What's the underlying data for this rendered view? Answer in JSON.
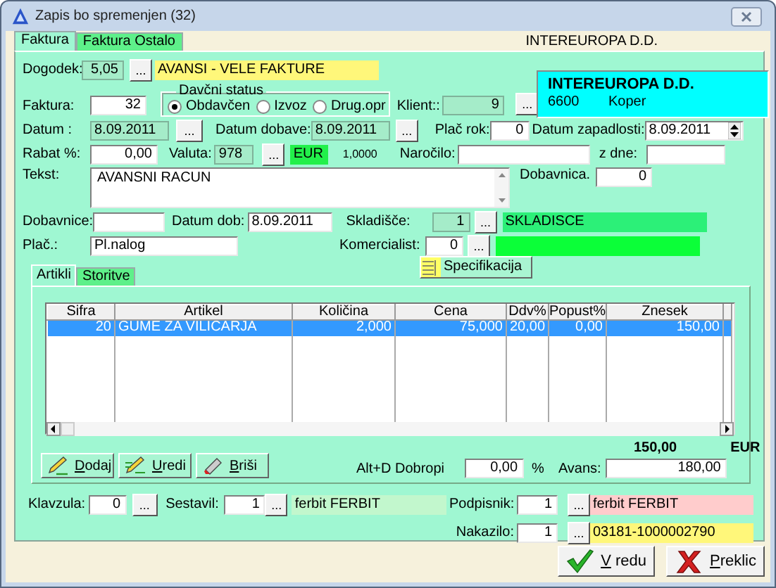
{
  "window": {
    "title": "Zapis bo spremenjen (32)"
  },
  "tabs": [
    {
      "label": "Faktura",
      "selected": true
    },
    {
      "label": "Faktura Ostalo",
      "selected": false
    }
  ],
  "company_header": "INTEREUROPA D.D.",
  "client_card": {
    "name": "INTEREUROPA D.D.",
    "postcode": "6600",
    "city": "Koper"
  },
  "dogodek": {
    "label": "Dogodek:",
    "code": "5,05",
    "readonly": true,
    "button": "...",
    "name": "AVANSI - VELE FAKTURE"
  },
  "tax_status": {
    "title": "Davčni status",
    "options": [
      {
        "label": "Obdavčen",
        "selected": true
      },
      {
        "label": "Izvoz",
        "selected": false
      },
      {
        "label": "Drug.opr",
        "selected": false
      }
    ]
  },
  "faktura": {
    "label": "Faktura:",
    "value": "32",
    "readonly": false
  },
  "klient": {
    "label": "Klient::",
    "value": "9",
    "readonly": true,
    "button": "..."
  },
  "datum": {
    "label": "Datum :",
    "value": "8.09.2011",
    "readonly": true,
    "button": "..."
  },
  "datum_dobave": {
    "label": "Datum dobave:",
    "value": "8.09.2011",
    "readonly": true,
    "button": "..."
  },
  "placilni_rok": {
    "label": "Plač rok:",
    "value": "0",
    "readonly": false
  },
  "datum_zapadlosti": {
    "label": "Datum zapadlosti:",
    "value": "8.09.2011",
    "readonly": false
  },
  "rabat": {
    "label": "Rabat %:",
    "value": "0,00",
    "readonly": false
  },
  "valuta": {
    "label": "Valuta:",
    "code": "978",
    "readonly": true,
    "button": "...",
    "name": "EUR",
    "rate": "1,0000"
  },
  "narocilo": {
    "label": "Naročilo:",
    "readonly": false
  },
  "z_dne": {
    "label": "z dne:",
    "readonly": false
  },
  "tekst": {
    "label": "Tekst:",
    "value": "AVANSNI RACUN",
    "readonly": false
  },
  "dobavnica": {
    "label": "Dobavnica.",
    "value": "0",
    "readonly": false
  },
  "dobavnice": {
    "label": "Dobavnice:",
    "readonly": false
  },
  "datum_dob": {
    "label": "Datum dob:",
    "value": "8.09.2011",
    "readonly": false
  },
  "skladisce": {
    "label": "Skladišče:",
    "code": "1",
    "readonly": true,
    "button": "...",
    "name": "SKLADISCE"
  },
  "placilo": {
    "label": "Plač.:",
    "value": "Pl.nalog",
    "readonly": false
  },
  "komercialist": {
    "label": "Komercialist:",
    "code": "0",
    "readonly": false,
    "button": "..."
  },
  "specifikacija_button": "Specifikacija",
  "item_tabs": [
    {
      "label": "Artikli",
      "selected": true
    },
    {
      "label": "Storitve",
      "selected": false
    }
  ],
  "table": {
    "columns": [
      "Sifra",
      "Artikel",
      "Količina",
      "Cena",
      "Ddv%",
      "Popust%",
      "Znesek"
    ],
    "rows": [
      {
        "selected": true,
        "cells": [
          "20",
          "GUME ZA VILICARJA",
          "2,000",
          "75,000",
          "20,00",
          "0,00",
          "150,00"
        ]
      }
    ]
  },
  "totals": {
    "amount": "150,00",
    "currency": "EUR"
  },
  "row_buttons": [
    {
      "label": "Dodaj",
      "kind": "add"
    },
    {
      "label": "Uredi",
      "kind": "edit"
    },
    {
      "label": "Briši",
      "kind": "delete"
    }
  ],
  "dobropis": {
    "label": "Alt+D Dobropi",
    "value": "0,00",
    "readonly": false,
    "unit": "%"
  },
  "avans": {
    "label": "Avans:",
    "value": "180,00",
    "readonly": false
  },
  "klavzula": {
    "label": "Klavzula:",
    "value": "0",
    "readonly": false,
    "button": "..."
  },
  "sestavil": {
    "label": "Sestavil:",
    "code": "1",
    "readonly": false,
    "button": "...",
    "name": "ferbit FERBIT"
  },
  "podpisnik": {
    "label": "Podpisnik:",
    "code": "1",
    "readonly": false,
    "button": "...",
    "name": "ferbit FERBIT"
  },
  "nakazilo": {
    "label": "Nakazilo:",
    "code": "1",
    "readonly": false,
    "button": "...",
    "name": "03181-1000002790"
  },
  "dialog_buttons": [
    {
      "label": "V redu",
      "kind": "ok"
    },
    {
      "label": "Preklic",
      "kind": "cancel"
    }
  ]
}
